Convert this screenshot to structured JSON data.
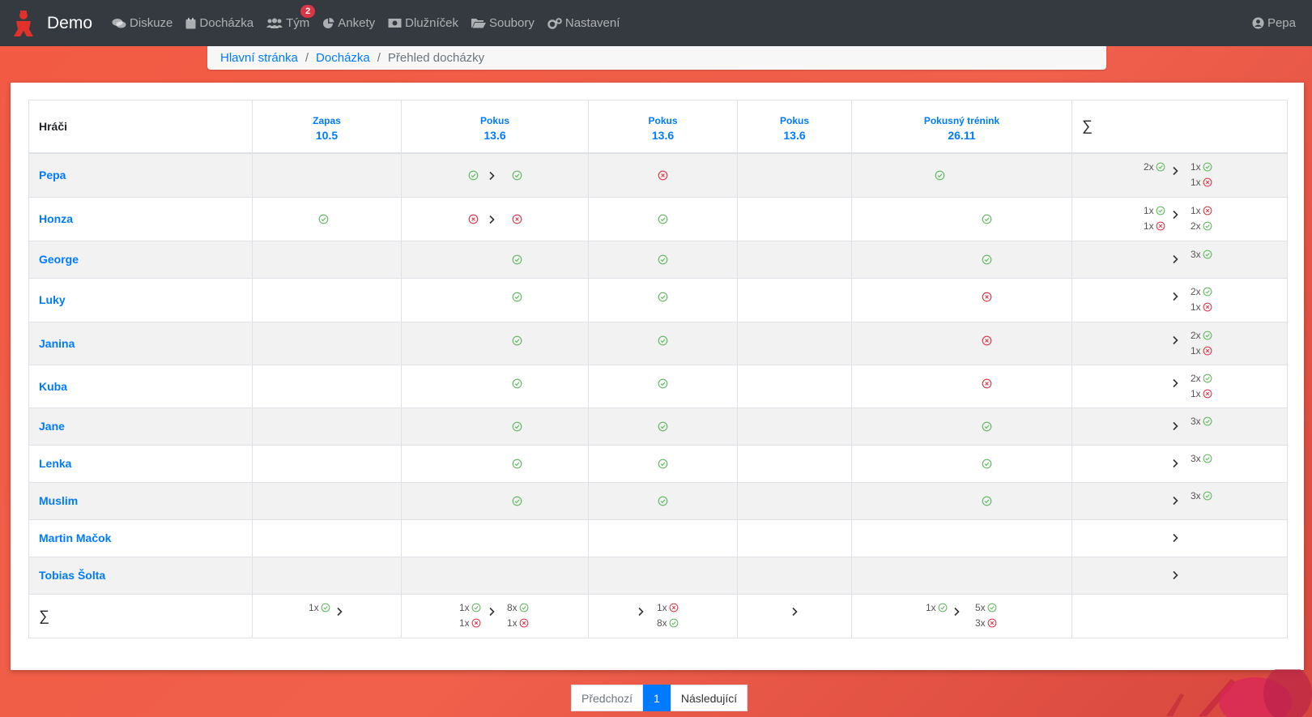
{
  "navbar": {
    "brand": "Demo",
    "items": [
      {
        "label": "Diskuze",
        "icon": "comments-icon"
      },
      {
        "label": "Docházka",
        "icon": "calendar-icon"
      },
      {
        "label": "Tým",
        "icon": "users-icon",
        "badge": "2"
      },
      {
        "label": "Ankety",
        "icon": "pie-chart-icon"
      },
      {
        "label": "Dlužníček",
        "icon": "money-icon"
      },
      {
        "label": "Soubory",
        "icon": "folder-open-icon"
      },
      {
        "label": "Nastavení",
        "icon": "cogs-icon"
      }
    ],
    "user": "Pepa"
  },
  "breadcrumb": {
    "home": "Hlavní stránka",
    "section": "Docházka",
    "current": "Přehled docházky",
    "separator": "/"
  },
  "table": {
    "players_header": "Hráči",
    "sum_symbol": "∑",
    "events": [
      {
        "name": "Zapas",
        "date": "10.5"
      },
      {
        "name": "Pokus",
        "date": "13.6"
      },
      {
        "name": "Pokus",
        "date": "13.6"
      },
      {
        "name": "Pokus",
        "date": "13.6"
      },
      {
        "name": "Pokusný trénink",
        "date": "26.11"
      }
    ],
    "players": [
      {
        "name": "Pepa"
      },
      {
        "name": "Honza"
      },
      {
        "name": "George"
      },
      {
        "name": "Luky"
      },
      {
        "name": "Janina"
      },
      {
        "name": "Kuba"
      },
      {
        "name": "Jane"
      },
      {
        "name": "Lenka"
      },
      {
        "name": "Muslim"
      },
      {
        "name": "Martin Mačok"
      },
      {
        "name": "Tobias Šolta"
      }
    ],
    "counts": {
      "c2x": "2x",
      "c1x": "1x",
      "c3x": "3x",
      "c5x": "5x",
      "c8x": "8x"
    }
  },
  "pagination": {
    "prev": "Předchozí",
    "page": "1",
    "next": "Následující"
  },
  "colors": {
    "accent": "#007bff",
    "ok": "#5cb85c",
    "no": "#dc3545",
    "navbar": "#343a40",
    "background": "#f25a43"
  }
}
